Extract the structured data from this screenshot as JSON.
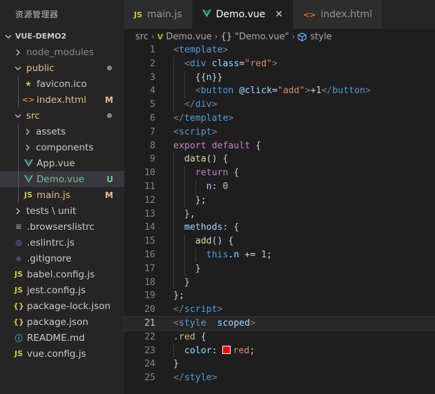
{
  "sidebar": {
    "title": "资源管理器",
    "project": "VUE-DEMO2",
    "items": [
      {
        "label": "node_modules",
        "status": "",
        "dot": false,
        "color": "#8c8c8c",
        "chevron": "›",
        "icon": "",
        "iconName": "folder",
        "depth": 0,
        "selected": false
      },
      {
        "label": "public",
        "status": "",
        "dot": true,
        "color": "#e2c08d",
        "chevron": "⌄",
        "icon": "",
        "iconName": "folder-open",
        "depth": 0,
        "selected": false
      },
      {
        "label": "favicon.ico",
        "status": "",
        "dot": false,
        "color": "#cccccc",
        "chevron": "",
        "icon": "★",
        "iconName": "star-icon",
        "iconColor": "#cbcb41",
        "depth": 1,
        "selected": false
      },
      {
        "label": "index.html",
        "status": "M",
        "dot": false,
        "color": "#e2c08d",
        "chevron": "",
        "icon": "<>",
        "iconName": "html-icon",
        "iconColor": "#e37933",
        "depth": 1,
        "selected": false
      },
      {
        "label": "src",
        "status": "",
        "dot": true,
        "color": "#e2c08d",
        "chevron": "⌄",
        "icon": "",
        "iconName": "folder-open",
        "depth": 0,
        "selected": false
      },
      {
        "label": "assets",
        "status": "",
        "dot": false,
        "color": "#cccccc",
        "chevron": "›",
        "icon": "",
        "iconName": "folder",
        "depth": 1,
        "selected": false
      },
      {
        "label": "components",
        "status": "",
        "dot": false,
        "color": "#cccccc",
        "chevron": "›",
        "icon": "",
        "iconName": "folder",
        "depth": 1,
        "selected": false
      },
      {
        "label": "App.vue",
        "status": "",
        "dot": false,
        "color": "#cccccc",
        "chevron": "",
        "icon": "V",
        "iconName": "vue-icon",
        "iconColor": "#8dc149",
        "depth": 1,
        "selected": false
      },
      {
        "label": "Demo.vue",
        "status": "U",
        "dot": false,
        "color": "#73c991",
        "chevron": "",
        "icon": "V",
        "iconName": "vue-icon",
        "iconColor": "#8dc149",
        "depth": 1,
        "selected": true
      },
      {
        "label": "main.js",
        "status": "M",
        "dot": false,
        "color": "#e2c08d",
        "chevron": "",
        "icon": "JS",
        "iconName": "js-icon",
        "iconColor": "#cbcb41",
        "depth": 1,
        "selected": false
      },
      {
        "label": "tests \\ unit",
        "status": "",
        "dot": false,
        "color": "#cccccc",
        "chevron": "›",
        "icon": "",
        "iconName": "folder",
        "depth": 0,
        "selected": false
      },
      {
        "label": ".browserslistrc",
        "status": "",
        "dot": false,
        "color": "#cccccc",
        "chevron": "",
        "icon": "≡",
        "iconName": "file-lines-icon",
        "iconColor": "#a0a0a0",
        "depth": 0,
        "selected": false
      },
      {
        "label": ".eslintrc.js",
        "status": "",
        "dot": false,
        "color": "#cccccc",
        "chevron": "",
        "icon": "◎",
        "iconName": "eslint-icon",
        "iconColor": "#a074c4",
        "depth": 0,
        "selected": false
      },
      {
        "label": ".gitignore",
        "status": "",
        "dot": false,
        "color": "#cccccc",
        "chevron": "",
        "icon": "◆",
        "iconName": "git-icon",
        "iconColor": "#41535b",
        "depth": 0,
        "selected": false
      },
      {
        "label": "babel.config.js",
        "status": "",
        "dot": false,
        "color": "#cccccc",
        "chevron": "",
        "icon": "JS",
        "iconName": "js-icon",
        "iconColor": "#cbcb41",
        "depth": 0,
        "selected": false
      },
      {
        "label": "jest.config.js",
        "status": "",
        "dot": false,
        "color": "#cccccc",
        "chevron": "",
        "icon": "JS",
        "iconName": "js-icon",
        "iconColor": "#cbcb41",
        "depth": 0,
        "selected": false
      },
      {
        "label": "package-lock.json",
        "status": "",
        "dot": false,
        "color": "#cccccc",
        "chevron": "",
        "icon": "{}",
        "iconName": "json-icon",
        "iconColor": "#cbcb41",
        "depth": 0,
        "selected": false
      },
      {
        "label": "package.json",
        "status": "",
        "dot": false,
        "color": "#cccccc",
        "chevron": "",
        "icon": "{}",
        "iconName": "json-icon",
        "iconColor": "#cbcb41",
        "depth": 0,
        "selected": false
      },
      {
        "label": "README.md",
        "status": "",
        "dot": false,
        "color": "#cccccc",
        "chevron": "",
        "icon": "ⓘ",
        "iconName": "info-icon",
        "iconColor": "#519aba",
        "depth": 0,
        "selected": false
      },
      {
        "label": "vue.config.js",
        "status": "",
        "dot": false,
        "color": "#cccccc",
        "chevron": "",
        "icon": "JS",
        "iconName": "js-icon",
        "iconColor": "#cbcb41",
        "depth": 0,
        "selected": false
      }
    ]
  },
  "tabs": [
    {
      "label": "main.js",
      "icon": "JS",
      "iconName": "js-icon",
      "iconColor": "#cbcb41",
      "active": false,
      "close": ""
    },
    {
      "label": "Demo.vue",
      "icon": "V",
      "iconName": "vue-icon",
      "iconColor": "#8dc149",
      "active": true,
      "close": "✕"
    },
    {
      "label": "index.html",
      "icon": "<>",
      "iconName": "html-icon",
      "iconColor": "#e37933",
      "active": false,
      "close": ""
    }
  ],
  "breadcrumb": {
    "folder": "src",
    "file": "Demo.vue",
    "component": "\"Demo.vue\"",
    "section": "style",
    "separator": "›"
  },
  "code": {
    "current_line": 21,
    "lines": [
      [
        [
          "<",
          "p"
        ],
        [
          "template",
          "t"
        ],
        [
          ">",
          "p"
        ]
      ],
      [
        [
          "  ",
          ""
        ],
        [
          "<",
          "p"
        ],
        [
          "div",
          "t"
        ],
        [
          " ",
          ""
        ],
        [
          "class",
          "a"
        ],
        [
          "=",
          "w"
        ],
        [
          "\"red\"",
          "s"
        ],
        [
          ">",
          "p"
        ]
      ],
      [
        [
          "    ",
          ""
        ],
        [
          "{{",
          "w"
        ],
        [
          "n",
          "a"
        ],
        [
          "}}",
          "w"
        ]
      ],
      [
        [
          "    ",
          ""
        ],
        [
          "<",
          "p"
        ],
        [
          "button",
          "t"
        ],
        [
          " ",
          ""
        ],
        [
          "@click",
          "a"
        ],
        [
          "=",
          "w"
        ],
        [
          "\"add\"",
          "s"
        ],
        [
          ">",
          "p"
        ],
        [
          "+1",
          "w"
        ],
        [
          "</",
          "p"
        ],
        [
          "button",
          "t"
        ],
        [
          ">",
          "p"
        ]
      ],
      [
        [
          "  ",
          ""
        ],
        [
          "</",
          "p"
        ],
        [
          "div",
          "t"
        ],
        [
          ">",
          "p"
        ]
      ],
      [
        [
          "</",
          "p"
        ],
        [
          "template",
          "t"
        ],
        [
          ">",
          "p"
        ]
      ],
      [
        [
          "<",
          "p"
        ],
        [
          "script",
          "t"
        ],
        [
          ">",
          "p"
        ]
      ],
      [
        [
          "export",
          "k"
        ],
        [
          " ",
          ""
        ],
        [
          "default",
          "k"
        ],
        [
          " {",
          "w"
        ]
      ],
      [
        [
          "  ",
          ""
        ],
        [
          "data",
          "f"
        ],
        [
          "() {",
          "w"
        ]
      ],
      [
        [
          "    ",
          ""
        ],
        [
          "return",
          "k"
        ],
        [
          " {",
          "w"
        ]
      ],
      [
        [
          "      ",
          ""
        ],
        [
          "n",
          "a"
        ],
        [
          ": ",
          "w"
        ],
        [
          "0",
          "n"
        ]
      ],
      [
        [
          "    ",
          ""
        ],
        [
          "};",
          "w"
        ]
      ],
      [
        [
          "  ",
          ""
        ],
        [
          "},",
          "w"
        ]
      ],
      [
        [
          "  ",
          ""
        ],
        [
          "methods",
          "a"
        ],
        [
          ": {",
          "w"
        ]
      ],
      [
        [
          "    ",
          ""
        ],
        [
          "add",
          "f"
        ],
        [
          "() {",
          "w"
        ]
      ],
      [
        [
          "      ",
          ""
        ],
        [
          "this",
          "t"
        ],
        [
          ".",
          "w"
        ],
        [
          "n",
          "a"
        ],
        [
          " += ",
          "w"
        ],
        [
          "1",
          "n"
        ],
        [
          ";",
          "w"
        ]
      ],
      [
        [
          "    ",
          ""
        ],
        [
          "}",
          "w"
        ]
      ],
      [
        [
          "  ",
          ""
        ],
        [
          "}",
          "w"
        ]
      ],
      [
        [
          "};",
          "w"
        ]
      ],
      [
        [
          "</",
          "p"
        ],
        [
          "script",
          "t"
        ],
        [
          ">",
          "p"
        ]
      ],
      [
        [
          "<",
          "p"
        ],
        [
          "style",
          "t"
        ],
        [
          "  ",
          ""
        ],
        [
          "scoped",
          "a"
        ],
        [
          ">",
          "p"
        ]
      ],
      [
        [
          ".red",
          "c"
        ],
        [
          " {",
          "w"
        ]
      ],
      [
        [
          "  ",
          ""
        ],
        [
          "color",
          "a"
        ],
        [
          ": ",
          "w"
        ],
        [
          "__SWATCH__",
          "sw"
        ],
        [
          "red",
          "s"
        ],
        [
          ";",
          "w"
        ]
      ],
      [
        [
          "}",
          "w"
        ]
      ],
      [
        [
          "</",
          "p"
        ],
        [
          "style",
          "t"
        ],
        [
          ">",
          "p"
        ]
      ]
    ]
  }
}
